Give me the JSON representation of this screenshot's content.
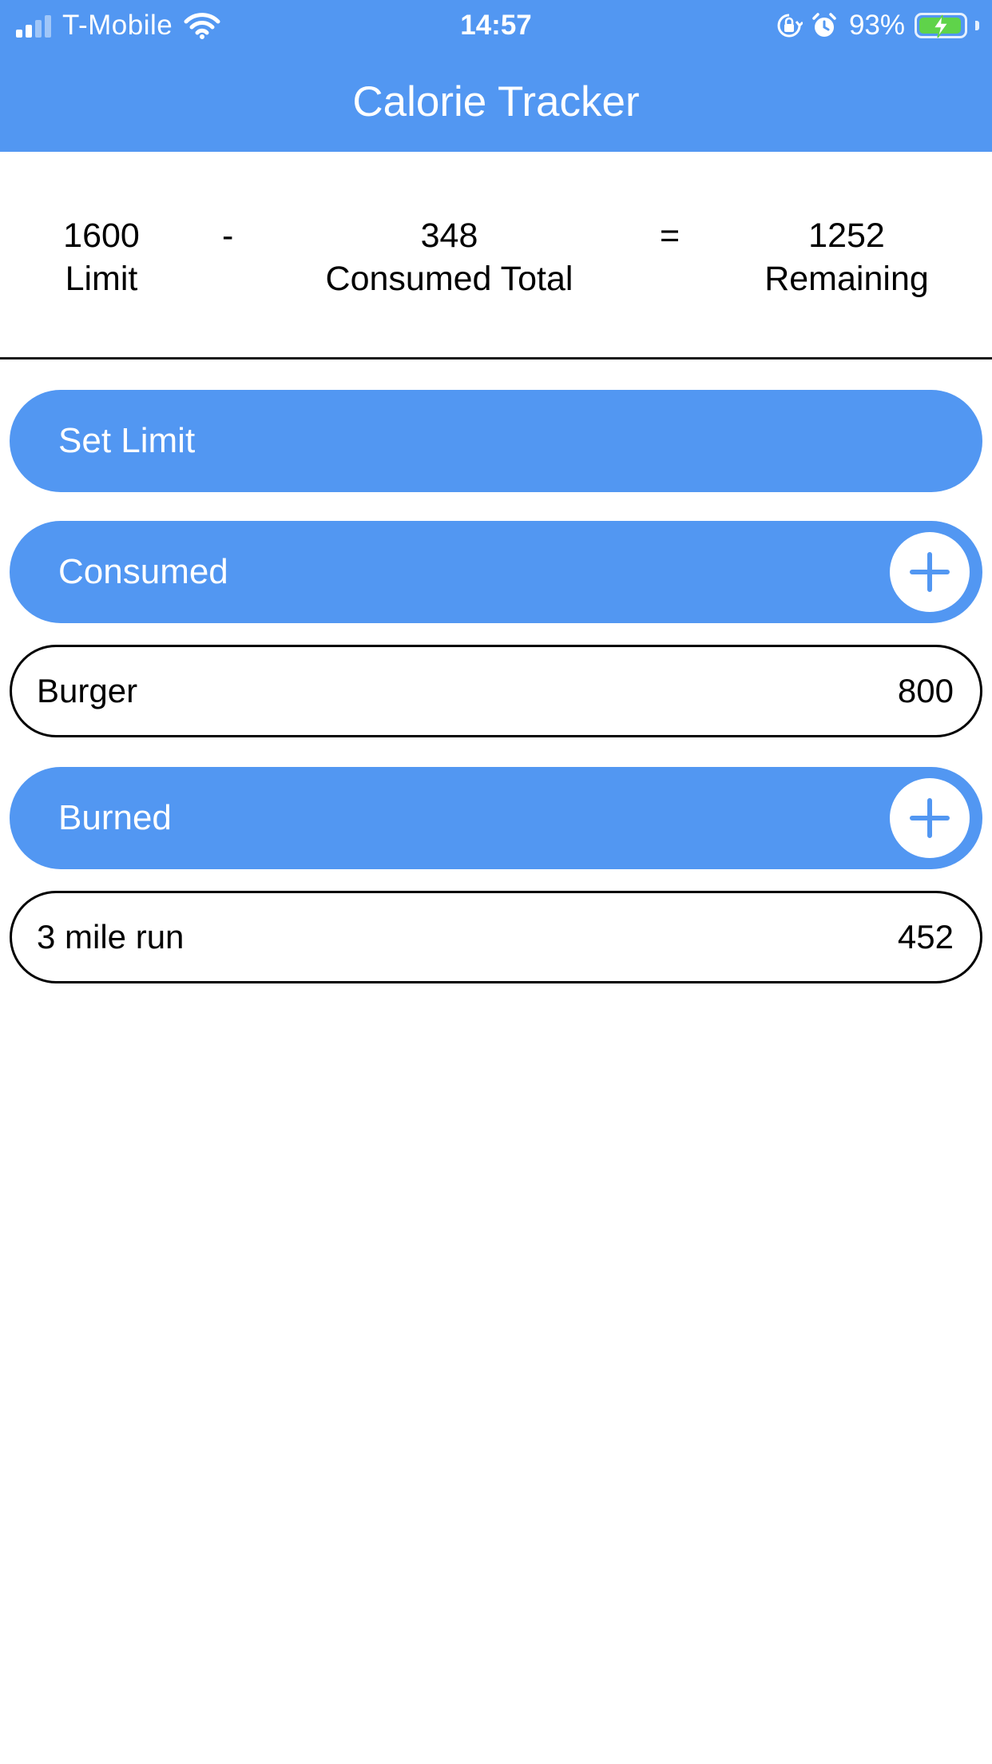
{
  "status_bar": {
    "carrier": "T-Mobile",
    "time": "14:57",
    "battery_percent": "93%",
    "icons": [
      "cellular-signal-icon",
      "wifi-icon",
      "orientation-lock-icon",
      "alarm-icon",
      "battery-charging-icon"
    ]
  },
  "header": {
    "title": "Calorie Tracker"
  },
  "summary": {
    "limit_value": "1600",
    "limit_label": "Limit",
    "minus_sign": "-",
    "consumed_value": "348",
    "consumed_label": "Consumed Total",
    "equals_sign": "=",
    "remaining_value": "1252",
    "remaining_label": "Remaining"
  },
  "sections": {
    "set_limit_label": "Set Limit",
    "consumed_label": "Consumed",
    "burned_label": "Burned"
  },
  "consumed_items": [
    {
      "name": "Burger",
      "calories": "800"
    }
  ],
  "burned_items": [
    {
      "name": "3 mile run",
      "calories": "452"
    }
  ],
  "colors": {
    "accent": "#5297f2",
    "background": "#ffffff",
    "battery_fill": "#5fd34a"
  }
}
